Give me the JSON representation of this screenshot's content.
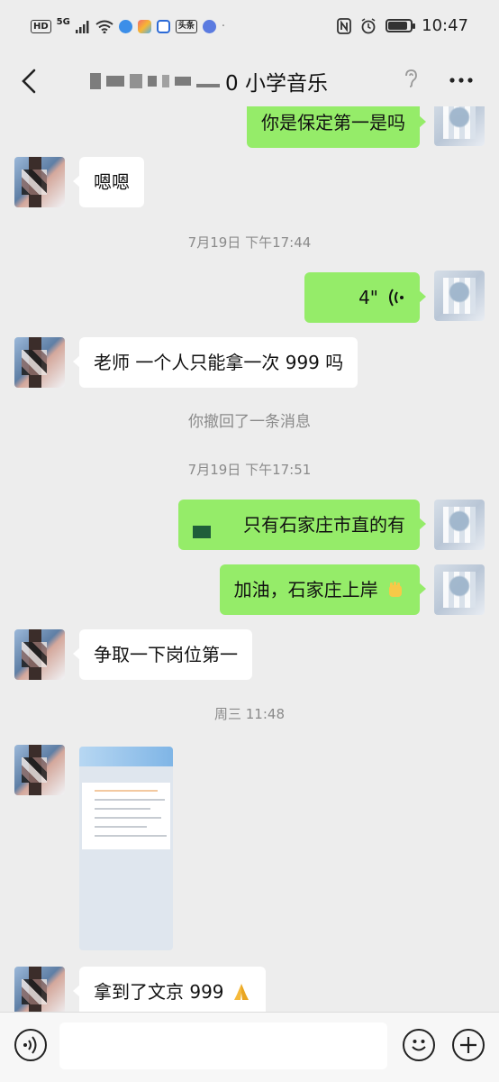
{
  "status_bar": {
    "badge_hd": "HD",
    "network": "5G",
    "app_tag": "头条",
    "time": "10:47",
    "battery_level": 0.85
  },
  "nav": {
    "title_visible": "0 小学音乐"
  },
  "messages": {
    "m1": "你是保定第一是吗",
    "m2": "嗯嗯",
    "t1": "7月19日 下午17:44",
    "m3_duration": "4\"",
    "m4": "老师  一个人只能拿一次 999 吗",
    "sys1": "你撤回了一条消息",
    "t2": "7月19日 下午17:51",
    "m5": "只有石家庄市直的有",
    "m6": "加油，石家庄上岸",
    "m7": "争取一下岗位第一",
    "t3": "周三 11:48",
    "m9": "拿到了文京 999"
  },
  "icons": {
    "back": "chevron-left-icon",
    "ear": "ear-icon",
    "more": "more-dots-icon",
    "voice": "voice-wave-icon",
    "emoji": "smile-face-icon",
    "plus": "plus-icon",
    "fist": "raised-fist-emoji",
    "pray": "folded-hands-emoji"
  },
  "colors": {
    "mine_bubble": "#95ec69",
    "their_bubble": "#ffffff",
    "background": "#ededed"
  },
  "input": {
    "placeholder": ""
  }
}
